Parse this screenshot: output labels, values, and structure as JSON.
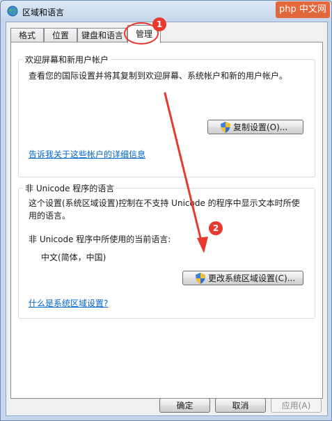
{
  "window": {
    "title": "区域和语言"
  },
  "tabs": [
    {
      "label": "格式"
    },
    {
      "label": "位置"
    },
    {
      "label": "键盘和语言"
    },
    {
      "label": "管理"
    }
  ],
  "welcome_group": {
    "title": "欢迎屏幕和新用户帐户",
    "description": "查看您的国际设置并将其复制到欢迎屏幕、系统帐户和新的用户帐户。",
    "copy_button": "复制设置(O)...",
    "link": "告诉我关于这些帐户的详细信息"
  },
  "unicode_group": {
    "title": "非 Unicode 程序的语言",
    "description_line1": "这个设置(系统区域设置)控制在不支持 Unicode 的程序中显示文本时所使",
    "description_line2": "用的语言。",
    "current_label": "非 Unicode 程序中所使用的当前语言:",
    "current_value": "中文(简体，中国)",
    "change_button": "更改系统区域设置(C)...",
    "link": "什么是系统区域设置?"
  },
  "footer": {
    "ok": "确定",
    "cancel": "取消",
    "apply": "应用(A)"
  },
  "annotations": {
    "step1": "1",
    "step2": "2",
    "color": "#e8392e"
  },
  "watermark": {
    "text": "php 中文网"
  }
}
